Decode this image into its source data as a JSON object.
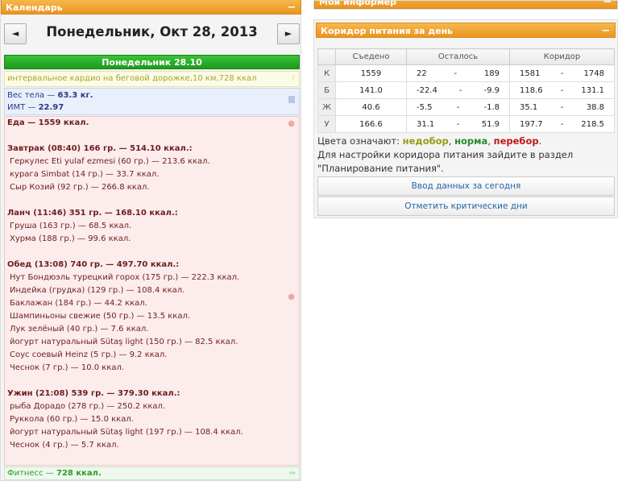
{
  "calendar": {
    "title": "Календарь",
    "collapse": "−",
    "prev": "◄",
    "next": "►",
    "date": "Понедельник, Окт 28, 2013"
  },
  "day": {
    "header": "Понедельник 28.10",
    "cardio": "интервальное кардио на беговой дорожке,10 км,728 ккал",
    "weight_label": "Вес тела — ",
    "weight_value": "63.3 кг.",
    "bmi_label": "ИМТ — ",
    "bmi_value": "22.97",
    "food_total": "Еда — 1559 ккал.",
    "meals": [
      {
        "title": "Завтрак (08:40) 166 гр. — 514.10 ккал.:",
        "items": [
          "Геркулес Eti yulaf ezmesi (60 гр.) — 213.6 ккал.",
          "курага Simbat (14 гр.) — 33.7 ккал.",
          "Сыр Козий (92 гр.) — 266.8 ккал."
        ]
      },
      {
        "title": "Ланч (11:46) 351 гр. — 168.10 ккал.:",
        "items": [
          "Груша (163 гр.) — 68.5 ккал.",
          "Хурма (188 гр.) — 99.6 ккал."
        ]
      },
      {
        "title": "Обед (13:08) 740 гр. — 497.70 ккал.:",
        "items": [
          "Нут Бондюэль турецкий горох (175 гр.) — 222.3 ккал.",
          "Индейка (грудка) (129 гр.) — 108.4 ккал.",
          "Баклажан (184 гр.) — 44.2 ккал.",
          "Шампиньоны свежие (50 гр.) — 13.5 ккал.",
          "Лук зелёный (40 гр.) — 7.6 ккал.",
          "йогурт натуральный Sütaş light (150 гр.) — 82.5 ккал.",
          "Соус соевый Heinz (5 гр.) — 9.2 ккал.",
          "Чеснок (7 гр.) — 10.0 ккал."
        ]
      },
      {
        "title": "Ужин (21:08) 539 гр. — 379.30 ккал.:",
        "items": [
          "рыба Дорадо (278 гр.) — 250.2 ккал.",
          "Руккола (60 гр.) — 15.0 ккал.",
          "йогурт натуральный Sütaş light (197 гр.) — 108.4 ккал.",
          "Чеснок (4 гр.) — 5.7 ккал."
        ]
      }
    ],
    "fitness_label": "Фитнесс — ",
    "fitness_value": "728 ккал."
  },
  "informer": {
    "title": "Мой информер"
  },
  "corridor": {
    "title": "Коридор питания за день",
    "collapse": "−",
    "headers": [
      "",
      "Съедено",
      "Осталось",
      "Коридор"
    ],
    "rows": [
      {
        "label": "К",
        "eaten": "1559",
        "status": "under",
        "rem_min": "22",
        "rem_max": "189",
        "cor_min": "1581",
        "cor_max": "1748"
      },
      {
        "label": "Б",
        "eaten": "141.0",
        "status": "over",
        "rem_min": "-22.4",
        "rem_max": "-9.9",
        "cor_min": "118.6",
        "cor_max": "131.1"
      },
      {
        "label": "Ж",
        "eaten": "40.6",
        "status": "over",
        "rem_min": "-5.5",
        "rem_max": "-1.8",
        "cor_min": "35.1",
        "cor_max": "38.8"
      },
      {
        "label": "У",
        "eaten": "166.6",
        "status": "under",
        "rem_min": "31.1",
        "rem_max": "51.9",
        "cor_min": "197.7",
        "cor_max": "218.5"
      }
    ],
    "dash": "-",
    "legend_prefix": "Цвета означают: ",
    "legend_under": "недобор",
    "legend_norm": "норма",
    "legend_over": "перебор",
    "legend_note": "Для настройки коридора питания зайдите в раздел \"Планирование питания\".",
    "btn_enter": "Ввод данных за сегодня",
    "btn_critical": "Отметить критические дни",
    "colors": {
      "under": "#9a9a1a",
      "norm": "#2a8a2a",
      "over": "#c01818"
    }
  }
}
